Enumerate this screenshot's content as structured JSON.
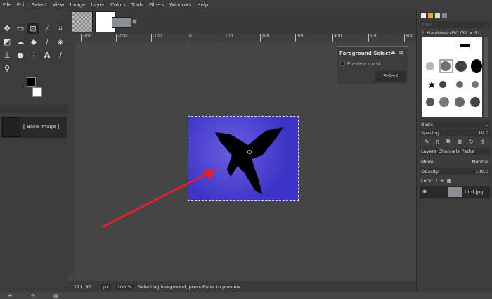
{
  "menu": [
    "File",
    "Edit",
    "Select",
    "View",
    "Image",
    "Layer",
    "Colors",
    "Tools",
    "Filters",
    "Windows",
    "Help"
  ],
  "toolbox": {
    "layer_label": "[ Base Image ]"
  },
  "ruler": {
    "h": [
      "-300",
      "-200",
      "-100",
      "0",
      "100",
      "200",
      "300",
      "400",
      "500",
      "600"
    ]
  },
  "fg_select": {
    "title": "Foreground Select",
    "preview_mask": "Preview mask",
    "select_btn": "Select"
  },
  "status": {
    "coords": "171, 87",
    "unit": "px",
    "zoom": "100 %",
    "message": "Selecting foreground, press Enter to preview."
  },
  "brushes": {
    "filter_placeholder": "filter",
    "selected": "2. Hardness 050 (51 × 51)",
    "preset": "Basic,",
    "spacing_label": "Spacing",
    "spacing_value": "10.0"
  },
  "layers": {
    "tabs": [
      "Layers",
      "Channels",
      "Paths"
    ],
    "mode_label": "Mode",
    "mode_value": "Normal",
    "opacity_label": "Opacity",
    "opacity_value": "100.0",
    "lock_label": "Lock:",
    "layer_name": "bird.jpg"
  },
  "colors": {
    "accent_arrow": "#e0202a",
    "image_bg": "#4a40d8"
  }
}
